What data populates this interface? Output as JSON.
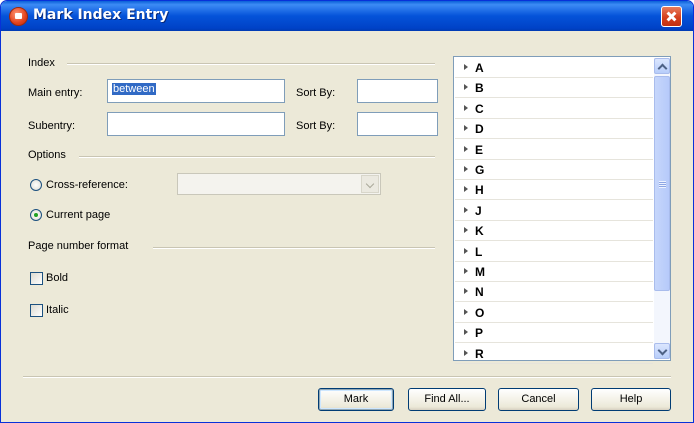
{
  "window": {
    "title": "Mark Index Entry",
    "close_icon": "close-icon"
  },
  "index_section": {
    "label": "Index",
    "main_entry_label": "Main entry:",
    "main_entry_value": "between",
    "sort_by_label": "Sort By:",
    "subentry_label": "Subentry:",
    "subentry_value": "",
    "sort_by_label_2": "Sort By:"
  },
  "options_section": {
    "label": "Options",
    "cross_reference_label": "Cross-reference:",
    "current_page_label": "Current page",
    "selected_option": "Current page"
  },
  "page_number_format": {
    "label": "Page number format",
    "bold_label": "Bold",
    "italic_label": "Italic",
    "bold_checked": false,
    "italic_checked": false
  },
  "index_list": {
    "letters": [
      "A",
      "B",
      "C",
      "D",
      "E",
      "G",
      "H",
      "J",
      "K",
      "L",
      "M",
      "N",
      "O",
      "P",
      "R"
    ]
  },
  "buttons": {
    "mark": "Mark",
    "find_all": "Find All...",
    "cancel": "Cancel",
    "help": "Help"
  },
  "colors": {
    "titlebar": "#0553d9",
    "dialog_bg": "#ece9d8",
    "selection": "#316ac5"
  }
}
